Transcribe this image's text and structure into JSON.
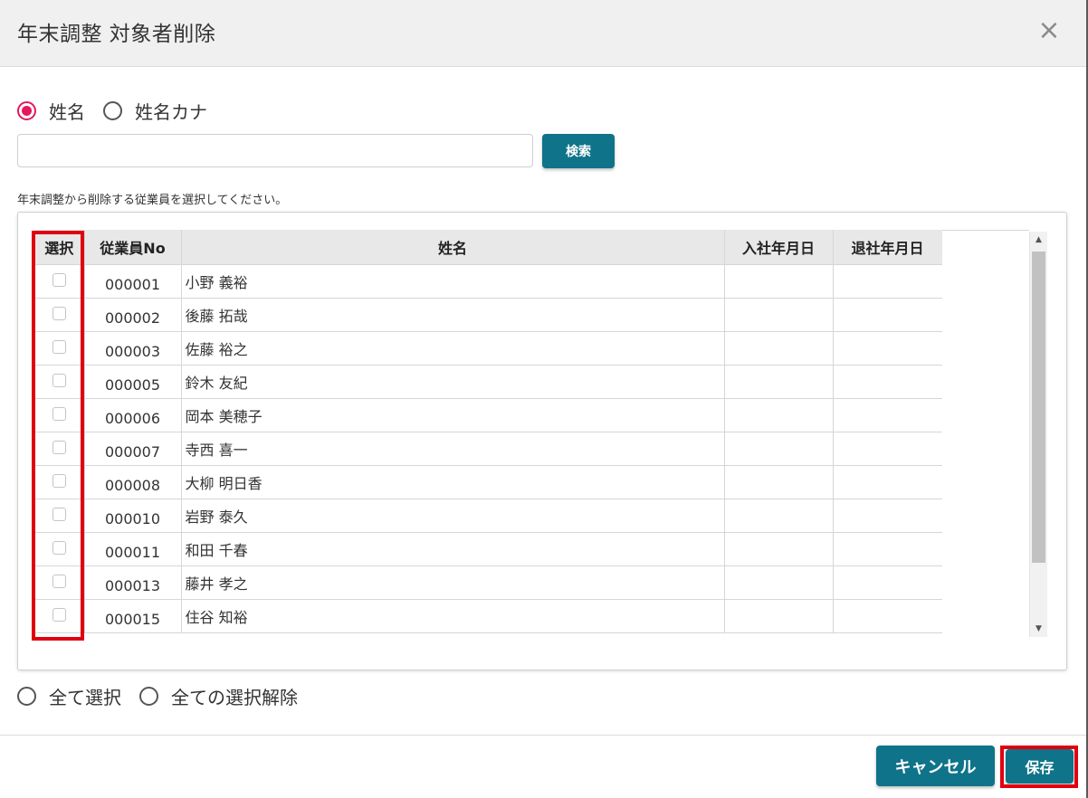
{
  "header": {
    "title": "年末調整 対象者削除",
    "close_symbol": "×"
  },
  "search_mode": {
    "options": [
      {
        "label": "姓名",
        "selected": true
      },
      {
        "label": "姓名カナ",
        "selected": false
      }
    ]
  },
  "search": {
    "value": "",
    "placeholder": "",
    "button_label": "検索"
  },
  "instruction": "年末調整から削除する従業員を選択してください。",
  "table": {
    "columns": [
      "選択",
      "従業員No",
      "姓名",
      "入社年月日",
      "退社年月日"
    ],
    "rows": [
      {
        "no": "000001",
        "name": "小野 義裕",
        "hire_date": "",
        "leave_date": "",
        "checked": false
      },
      {
        "no": "000002",
        "name": "後藤 拓哉",
        "hire_date": "",
        "leave_date": "",
        "checked": false
      },
      {
        "no": "000003",
        "name": "佐藤 裕之",
        "hire_date": "",
        "leave_date": "",
        "checked": false
      },
      {
        "no": "000005",
        "name": "鈴木 友紀",
        "hire_date": "",
        "leave_date": "",
        "checked": false
      },
      {
        "no": "000006",
        "name": "岡本 美穂子",
        "hire_date": "",
        "leave_date": "",
        "checked": false
      },
      {
        "no": "000007",
        "name": "寺西 喜一",
        "hire_date": "",
        "leave_date": "",
        "checked": false
      },
      {
        "no": "000008",
        "name": "大柳 明日香",
        "hire_date": "",
        "leave_date": "",
        "checked": false
      },
      {
        "no": "000010",
        "name": "岩野 泰久",
        "hire_date": "",
        "leave_date": "",
        "checked": false
      },
      {
        "no": "000011",
        "name": "和田 千春",
        "hire_date": "",
        "leave_date": "",
        "checked": false
      },
      {
        "no": "000013",
        "name": "藤井 孝之",
        "hire_date": "",
        "leave_date": "",
        "checked": false
      },
      {
        "no": "000015",
        "name": "住谷 知裕",
        "hire_date": "",
        "leave_date": "",
        "checked": false
      }
    ]
  },
  "bulk_select": {
    "options": [
      {
        "label": "全て選択",
        "selected": false
      },
      {
        "label": "全ての選択解除",
        "selected": false
      }
    ]
  },
  "footer": {
    "cancel_label": "キャンセル",
    "save_label": "保存"
  },
  "colors": {
    "accent_teal": "#0f7389",
    "radio_selected": "#e5175f",
    "highlight_red": "#e0000f"
  },
  "icons": {
    "close": "close-icon",
    "scroll_up": "scroll-up-arrow-icon",
    "scroll_down": "scroll-down-arrow-icon"
  }
}
